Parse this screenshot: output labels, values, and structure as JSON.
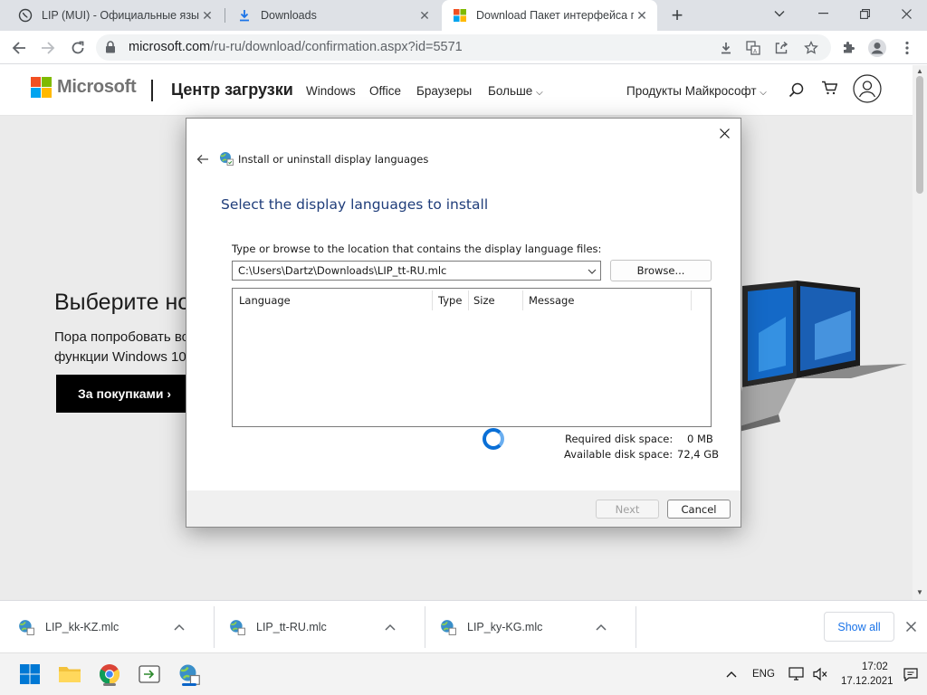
{
  "browser": {
    "tabs": [
      {
        "title": "LIP (MUI) - Официальные языко",
        "icon": "globe-phone-icon",
        "active": false
      },
      {
        "title": "Downloads",
        "icon": "download-icon",
        "active": false
      },
      {
        "title": "Download Пакет интерфейса п",
        "icon": "microsoft-logo-icon",
        "active": true
      }
    ],
    "url_host": "microsoft.com",
    "url_path": "/ru-ru/download/confirmation.aspx?id=5571"
  },
  "site": {
    "brand": "Microsoft",
    "section_title": "Центр загрузки",
    "nav": [
      "Windows",
      "Office",
      "Браузеры",
      "Больше"
    ],
    "products_menu": "Продукты Майкрософт",
    "hero_heading": "Выберите нов",
    "hero_text_1": "Пора попробовать во",
    "hero_text_2": "функции Windows 10",
    "hero_button": "За покупками"
  },
  "dialog": {
    "title": "Install or uninstall display languages",
    "heading": "Select the display languages to install",
    "prompt": "Type or browse to the location that contains the display language files:",
    "path_value": "C:\\Users\\Dartz\\Downloads\\LIP_tt-RU.mlc",
    "browse_label": "Browse...",
    "columns": [
      "Language",
      "Type",
      "Size",
      "Message"
    ],
    "required_label": "Required disk space:",
    "required_value": "0 MB",
    "available_label": "Available disk space:",
    "available_value": "72,4 GB",
    "next_label": "Next",
    "cancel_label": "Cancel"
  },
  "downloads": {
    "items": [
      "LIP_kk-KZ.mlc",
      "LIP_tt-RU.mlc",
      "LIP_ky-KG.mlc"
    ],
    "show_all": "Show all"
  },
  "taskbar": {
    "language": "ENG",
    "time": "17:02",
    "date": "17.12.2021"
  },
  "colors": {
    "accent_blue": "#1a73e8",
    "dialog_heading": "#1f3d7a",
    "spinner": "#0a6fd6"
  }
}
